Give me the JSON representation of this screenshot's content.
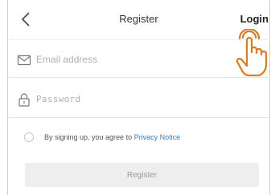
{
  "header": {
    "title": "Register",
    "login_label": "Login",
    "back_icon": "chevron-left-icon"
  },
  "form": {
    "email": {
      "placeholder": "Email address",
      "value": "",
      "icon": "envelope-icon"
    },
    "password": {
      "placeholder": "Password",
      "value": "",
      "icon": "lock-icon"
    }
  },
  "agreement": {
    "prefix": "By signing up, you agree to ",
    "link_label": "Privacy Notice",
    "checked": false
  },
  "register_button": {
    "label": "Register",
    "enabled": false
  },
  "colors": {
    "link": "#2f7fe0",
    "cursor_accent": "#e07a1f",
    "button_bg": "#eeeeee",
    "button_text": "#9a9a9a"
  },
  "cursor_icon": "hand-pointer-icon"
}
